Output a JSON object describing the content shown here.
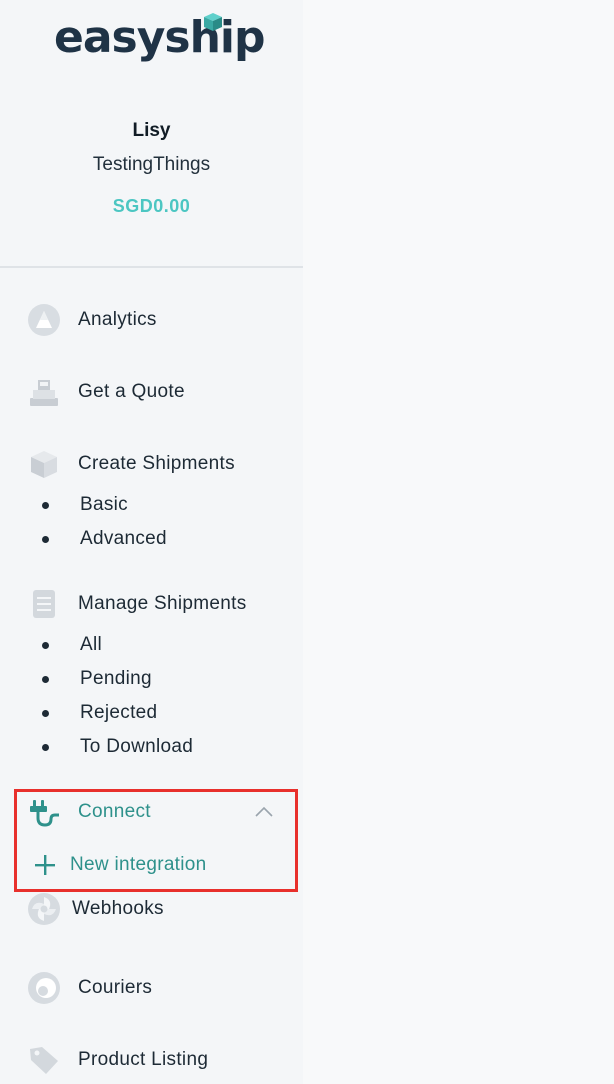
{
  "brand": {
    "logo_text": "easyship",
    "accent_color": "#4cc6c2",
    "connect_color": "#2e918b",
    "highlight_color": "#e8302c"
  },
  "profile": {
    "user_name": "Lisy",
    "company": "TestingThings",
    "balance": "SGD0.00"
  },
  "nav": {
    "analytics": {
      "label": "Analytics",
      "icon": "analytics-icon"
    },
    "get_quote": {
      "label": "Get a Quote",
      "icon": "quote-icon"
    },
    "create_shipments": {
      "label": "Create Shipments",
      "icon": "box-icon",
      "items": [
        {
          "label": "Basic"
        },
        {
          "label": "Advanced"
        }
      ]
    },
    "manage_shipments": {
      "label": "Manage Shipments",
      "icon": "clipboard-icon",
      "items": [
        {
          "label": "All"
        },
        {
          "label": "Pending"
        },
        {
          "label": "Rejected"
        },
        {
          "label": "To Download"
        }
      ]
    },
    "connect": {
      "label": "Connect",
      "icon": "plug-icon",
      "expanded": true,
      "items": [
        {
          "label": "New integration",
          "icon": "plus-icon"
        }
      ]
    },
    "webhooks": {
      "label": "Webhooks",
      "icon": "webhooks-icon"
    },
    "couriers": {
      "label": "Couriers",
      "icon": "couriers-icon"
    },
    "product_listing": {
      "label": "Product Listing",
      "icon": "tag-icon"
    }
  }
}
